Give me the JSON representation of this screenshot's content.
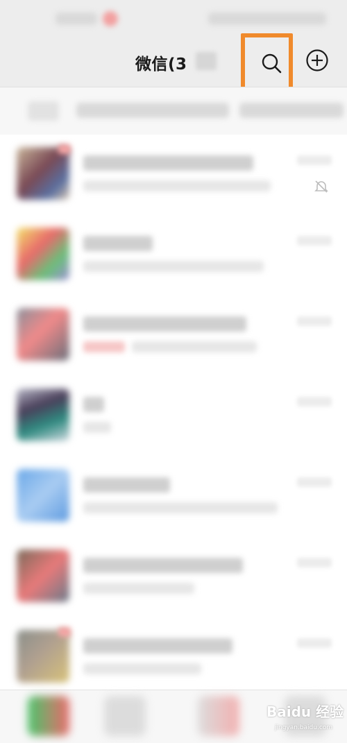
{
  "header": {
    "title": "微信(3"
  },
  "icons": {
    "search": "search-icon",
    "add": "plus-circle-icon",
    "mute": "bell-muted-icon"
  },
  "colors": {
    "highlight": "#f08a2c",
    "background": "#ededed"
  },
  "watermark": {
    "brand": "Baidu 经验",
    "url": "jingyan.baidu.com"
  }
}
